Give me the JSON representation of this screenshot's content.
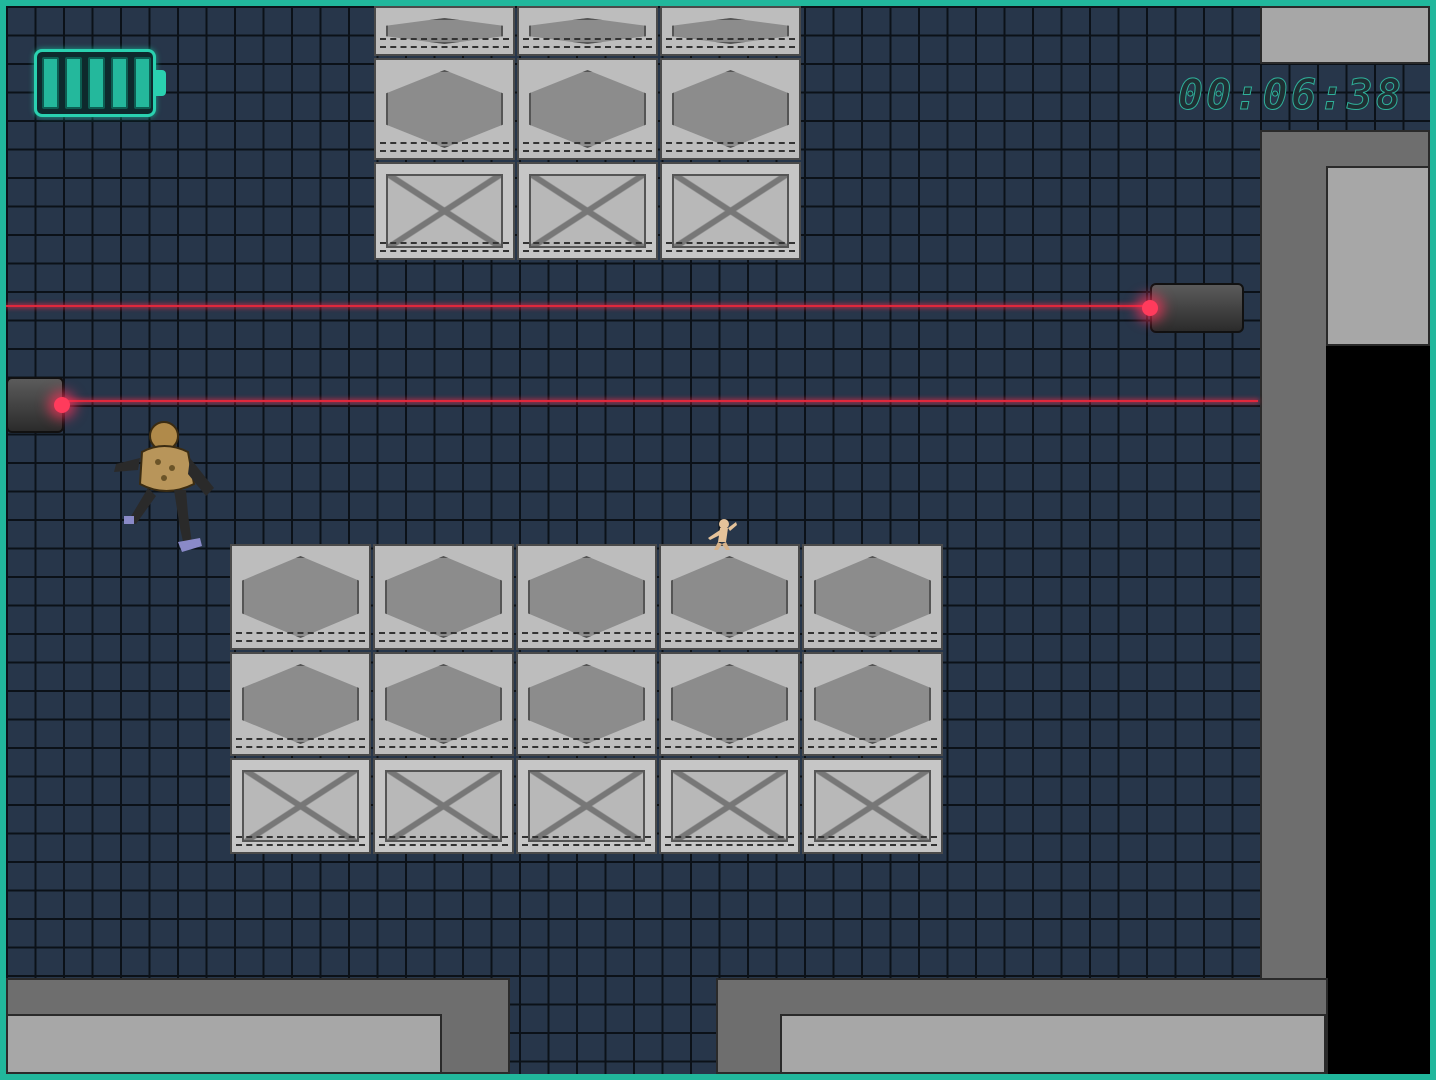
{
  "hud": {
    "timer": "00:06:38",
    "battery": {
      "cells_filled": 5,
      "cells_total": 5,
      "level_fraction": 1.0
    }
  },
  "colors": {
    "frame": "#21b79c",
    "floor": "#27364a",
    "grid_line": "#0b1118",
    "laser": "#e0283c",
    "wall_dark": "#6e6e6e",
    "wall_light": "#a7a7a7",
    "battery": "#2ad1b0"
  },
  "entities": {
    "player": {
      "icon": "player-character-icon"
    },
    "enemy": {
      "icon": "armored-guard-icon"
    },
    "crates": {
      "top_stack_count": 9,
      "bottom_stack_count": 15
    },
    "laser_turrets": 2,
    "laser_beams": 2
  }
}
